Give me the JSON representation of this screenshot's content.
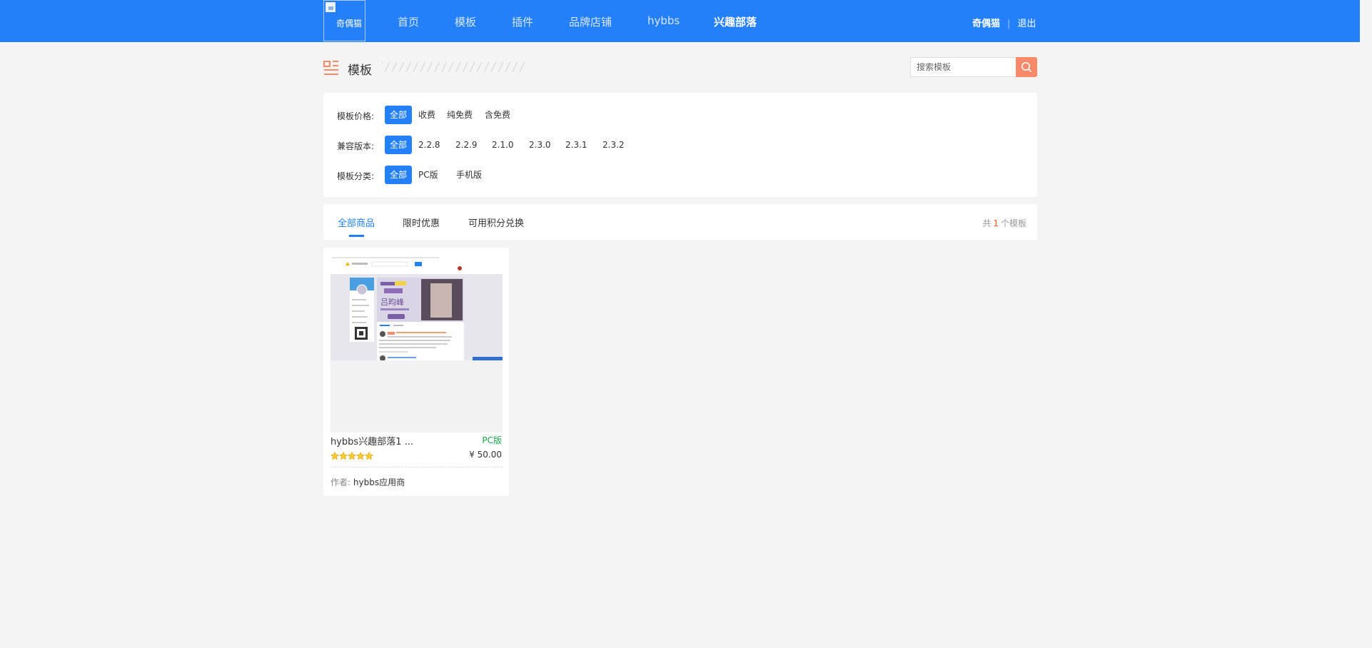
{
  "header": {
    "logo_alt": "奇偶猫",
    "nav": [
      "首页",
      "模板",
      "插件",
      "品牌店铺",
      "hybbs",
      "兴趣部落"
    ],
    "active_nav": "兴趣部落",
    "username": "奇偶猫",
    "separator": "|",
    "logout": "退出"
  },
  "section": {
    "title": "模板",
    "search_placeholder": "搜索模板"
  },
  "filters": {
    "price": {
      "label": "模板价格:",
      "options": [
        "全部",
        "收费",
        "纯免费",
        "含免费"
      ],
      "selected": "全部"
    },
    "version": {
      "label": "兼容版本:",
      "options": [
        "全部",
        "2.2.8",
        "2.2.9",
        "2.1.0",
        "2.3.0",
        "2.3.1",
        "2.3.2"
      ],
      "selected": "全部"
    },
    "category": {
      "label": "模板分类:",
      "options": [
        "全部",
        "PC版",
        "手机版"
      ],
      "selected": "全部"
    }
  },
  "tabs": {
    "items": [
      "全部商品",
      "限时优惠",
      "可用积分兑换"
    ],
    "active": "全部商品",
    "count_prefix": "共",
    "count_value": "1",
    "count_suffix": "个模板"
  },
  "products": [
    {
      "title": "hybbs兴趣部落1 ...",
      "type": "PC版",
      "rating": 5,
      "price": "¥ 50.00",
      "author_label": "作者:",
      "author": "hybbs应用商"
    }
  ],
  "colors": {
    "primary": "#2380f9",
    "accent": "#f98a69",
    "type_green": "#1aa34a",
    "count_red": "#ff5722"
  }
}
